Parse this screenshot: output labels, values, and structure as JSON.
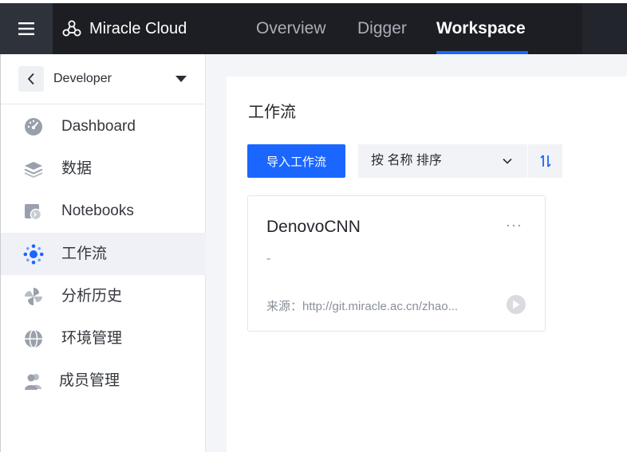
{
  "topbar": {
    "menu_icon": "hamburger-icon",
    "brand_icon": "molecule-icon",
    "brand_name": "Miracle Cloud",
    "tabs": [
      {
        "label": "Overview",
        "active": false
      },
      {
        "label": "Digger",
        "active": false
      },
      {
        "label": "Workspace",
        "active": true
      }
    ]
  },
  "sidebar": {
    "project": "Developer",
    "items": [
      {
        "label": "Dashboard",
        "icon": "gauge-icon",
        "active": false
      },
      {
        "label": "数据",
        "icon": "layers-icon",
        "active": false
      },
      {
        "label": "Notebooks",
        "icon": "notebook-icon",
        "active": false
      },
      {
        "label": "工作流",
        "icon": "workflow-icon",
        "active": true
      },
      {
        "label": "分析历史",
        "icon": "pinwheel-icon",
        "active": false
      },
      {
        "label": "环境管理",
        "icon": "globe-icon",
        "active": false
      },
      {
        "label": "成员管理",
        "icon": "users-icon",
        "active": false
      }
    ]
  },
  "main": {
    "title": "工作流",
    "import_button": "导入工作流",
    "sort_label": "按 名称 排序",
    "cards": [
      {
        "title": "DenovoCNN",
        "more": "···",
        "description": "-",
        "source": "来源：http://git.miracle.ac.cn/zhao..."
      }
    ]
  },
  "colors": {
    "accent": "#1a66ff",
    "topbar": "#1c1e23",
    "active_item_bg": "#eff1f6"
  }
}
